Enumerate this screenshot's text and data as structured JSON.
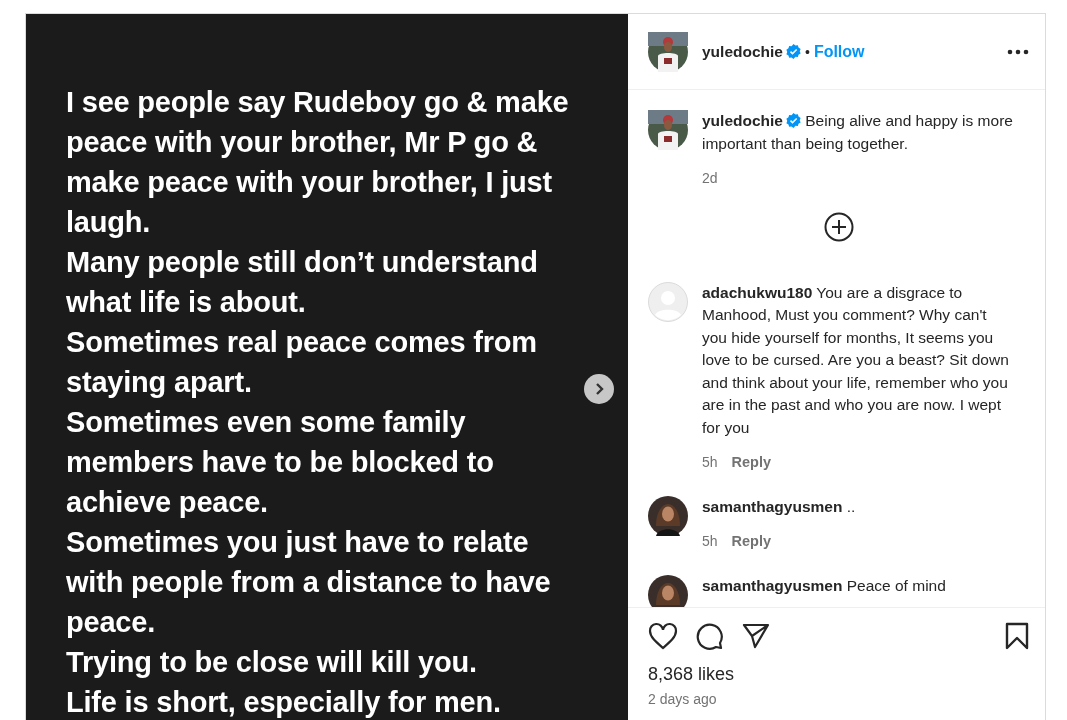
{
  "post_image": {
    "paragraphs": [
      "I see people say Rudeboy go & make peace with your brother, Mr P go & make peace with your brother, I just laugh.",
      "Many people still don’t understand what life is about.",
      "Sometimes real peace comes from staying apart.",
      "Sometimes even some family members have to be blocked to achieve peace.",
      "Sometimes you just have to relate with people from a distance to have peace.",
      "Trying to be close will kill you.",
      "Life is short, especially for men."
    ]
  },
  "header": {
    "username": "yuledochie",
    "verified": true,
    "separator": "•",
    "follow": "Follow"
  },
  "caption": {
    "username": "yuledochie",
    "verified": true,
    "text": "Being alive and happy is more important than being together.",
    "time": "2d"
  },
  "comments": [
    {
      "kind": "default",
      "username": "adachukwu180",
      "text": "You are a disgrace to Manhood, Must you comment? Why can't you hide yourself for months, It seems you love to be cursed. Are you a beast? Sit down and think about your life, remember who you are in the past and who you are now. I wept for you",
      "time": "5h",
      "reply": "Reply"
    },
    {
      "kind": "photo",
      "username": "samanthagyusmen",
      "text": "..",
      "time": "5h",
      "reply": "Reply"
    },
    {
      "kind": "photo",
      "username": "samanthagyusmen",
      "text": "Peace of mind"
    }
  ],
  "likes": "8,368 likes",
  "date": "2 days ago"
}
